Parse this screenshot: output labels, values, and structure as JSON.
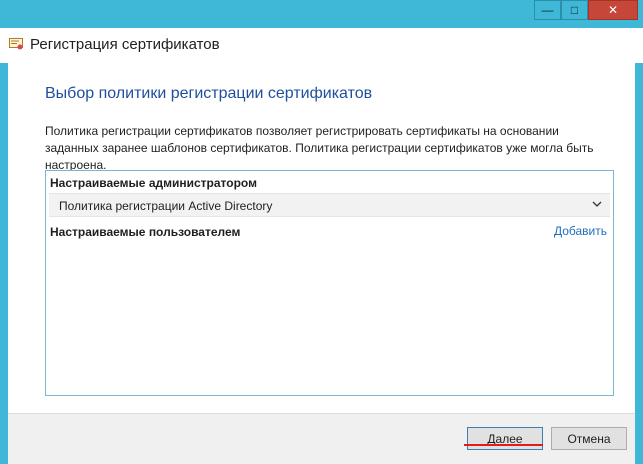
{
  "window": {
    "title": "Регистрация сертификатов",
    "controls": {
      "minimize": "—",
      "maximize": "□",
      "close": "✕"
    }
  },
  "page": {
    "heading": "Выбор политики регистрации сертификатов",
    "description": "Политика регистрации сертификатов позволяет регистрировать сертификаты на основании заданных заранее шаблонов сертификатов. Политика регистрации сертификатов уже могла быть настроена."
  },
  "panel": {
    "admin_group_label": "Настраиваемые администратором",
    "policy_item": "Политика регистрации Active Directory",
    "user_group_label": "Настраиваемые пользователем",
    "add_link": "Добавить"
  },
  "footer": {
    "next_label": "Далее",
    "cancel_label": "Отмена"
  },
  "colors": {
    "window_frame": "#3fb8d8",
    "heading": "#1f4e9f",
    "link": "#1f6fb9",
    "close_button": "#c7463a",
    "annotation_underline": "#e21c1c"
  }
}
